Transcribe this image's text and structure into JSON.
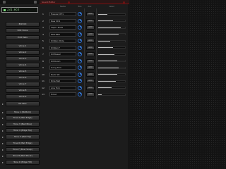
{
  "sidebar": {
    "lcd_text": "231.ec4",
    "buttons": [
      "Edit Kit",
      "Edit Voice",
      "Edit Pads",
      "Voice 1",
      "Voice 2",
      "Voice 3",
      "Voice 4",
      "Voice 5",
      "Voice 6",
      "Voice 7",
      "Voice 8",
      "Voice 9",
      "Kit Wav",
      "Tone 1 (Bottom)",
      "Tone 2 (Bell Edge)",
      "Tone 3 (Bell Bow)",
      "Tone 4 (Edge Tip)",
      "Tone 5 (Bell Tip)",
      "Tone 6 (Bell Edge)",
      "Tone 7 (Bow Snap)",
      "Tone 8 (Bell Pluck)",
      "Tone 9 (Edge Hit)",
      "Import / Export",
      "Exit"
    ],
    "highlighted": "Import / Export"
  },
  "panel": {
    "title": "Sound Editor",
    "headers": {
      "name": "Name",
      "pan": "Pan",
      "aux": "Aux",
      "level": "Level"
    },
    "rows": [
      {
        "num": "1",
        "name": "Heaven RT1",
        "aux": "AUX",
        "level": 0.35
      },
      {
        "num": "2",
        "name": "Raw SD1",
        "aux": "AUX",
        "level": 0.55
      },
      {
        "num": "3",
        "name": "Vapor Mute",
        "aux": "AUX",
        "level": 0.85
      },
      {
        "num": "4",
        "name": "808 BDX",
        "aux": "AUX",
        "level": 0.75
      },
      {
        "num": "5",
        "name": "Zildjian Ride",
        "aux": "AUX",
        "level": 0.45
      },
      {
        "num": "6",
        "name": "Zildjian7",
        "aux": "AUX",
        "level": 0.55
      },
      {
        "num": "7",
        "name": "Kit Bass2",
        "aux": "AUX",
        "level": 0.6
      },
      {
        "num": "8",
        "name": "Kit Room",
        "aux": "AUX",
        "level": 0.7
      },
      {
        "num": "9",
        "name": "Gong Tom",
        "aux": "AUX",
        "level": 0.75
      },
      {
        "num": "10",
        "name": "Rack SD",
        "aux": "AUX",
        "level": 0.7
      },
      {
        "num": "11",
        "name": "Ride Bell",
        "aux": "AUX",
        "level": 0.65
      },
      {
        "num": "12",
        "name": "Low Tom",
        "aux": "AUX",
        "level": 0.5
      },
      {
        "num": "13",
        "name": "Hihat",
        "aux": "AUX",
        "level": 0.12
      }
    ]
  }
}
